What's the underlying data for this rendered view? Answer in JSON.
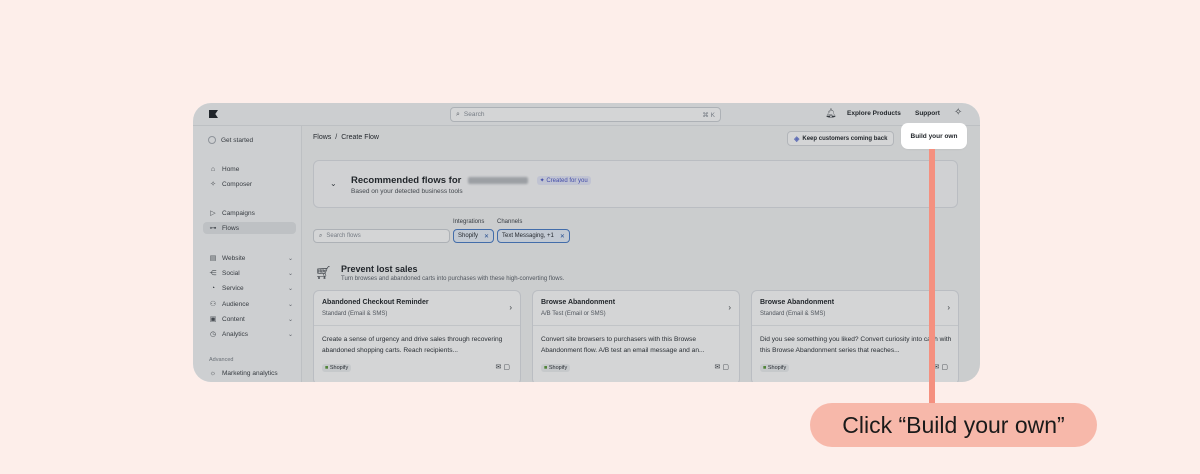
{
  "topbar": {
    "search_placeholder": "Search",
    "search_shortcut": "⌘ K",
    "explore_products": "Explore Products",
    "support": "Support"
  },
  "sidebar": {
    "get_started": "Get started",
    "items_primary": [
      {
        "label": "Home",
        "icon": "home-icon"
      },
      {
        "label": "Composer",
        "icon": "sparkle-icon"
      }
    ],
    "items_secondary": [
      {
        "label": "Campaigns",
        "icon": "send-icon"
      },
      {
        "label": "Flows",
        "icon": "flows-icon",
        "active": true
      }
    ],
    "items_groups": [
      {
        "label": "Website",
        "icon": "website-icon"
      },
      {
        "label": "Social",
        "icon": "social-icon"
      },
      {
        "label": "Service",
        "icon": "service-icon"
      },
      {
        "label": "Audience",
        "icon": "audience-icon"
      },
      {
        "label": "Content",
        "icon": "content-icon"
      },
      {
        "label": "Analytics",
        "icon": "analytics-icon"
      }
    ],
    "advanced_label": "Advanced",
    "marketing_analytics": "Marketing analytics"
  },
  "main": {
    "breadcrumb_root": "Flows",
    "breadcrumb_sep": "/",
    "breadcrumb_current": "Create Flow",
    "keep_customers_button": "Keep customers coming back",
    "build_own_button": "Build your own",
    "recommended": {
      "title": "Recommended flows for",
      "badge": "Created for you",
      "subtitle": "Based on your detected business tools"
    },
    "filters": {
      "search_placeholder": "Search flows",
      "integrations_label": "Integrations",
      "channels_label": "Channels",
      "integration_chip": "Shopify",
      "channel_chip": "Text Messaging, +1"
    },
    "section": {
      "title": "Prevent lost sales",
      "subtitle": "Turn browses and abandoned carts into purchases with these high-converting flows."
    },
    "cards": [
      {
        "title": "Abandoned Checkout Reminder",
        "type": "Standard (Email & SMS)",
        "description": "Create a sense of urgency and drive sales through recovering abandoned shopping carts. Reach recipients...",
        "tag": "Shopify"
      },
      {
        "title": "Browse Abandonment",
        "type": "A/B Test (Email or SMS)",
        "description": "Convert site browsers to purchasers with this Browse Abandonment flow. A/B test an email message and an...",
        "tag": "Shopify"
      },
      {
        "title": "Browse Abandonment",
        "type": "Standard (Email & SMS)",
        "description": "Did you see something you liked? Convert curiosity into cash with this Browse Abandonment series that reaches...",
        "tag": "Shopify"
      }
    ]
  },
  "callout": {
    "text": "Click “Build your own”"
  },
  "colors": {
    "page_bg": "#fdeeea",
    "callout_bg": "#f7b8aa",
    "pointer": "#f5907f",
    "chip_border": "#4a7ec9"
  }
}
